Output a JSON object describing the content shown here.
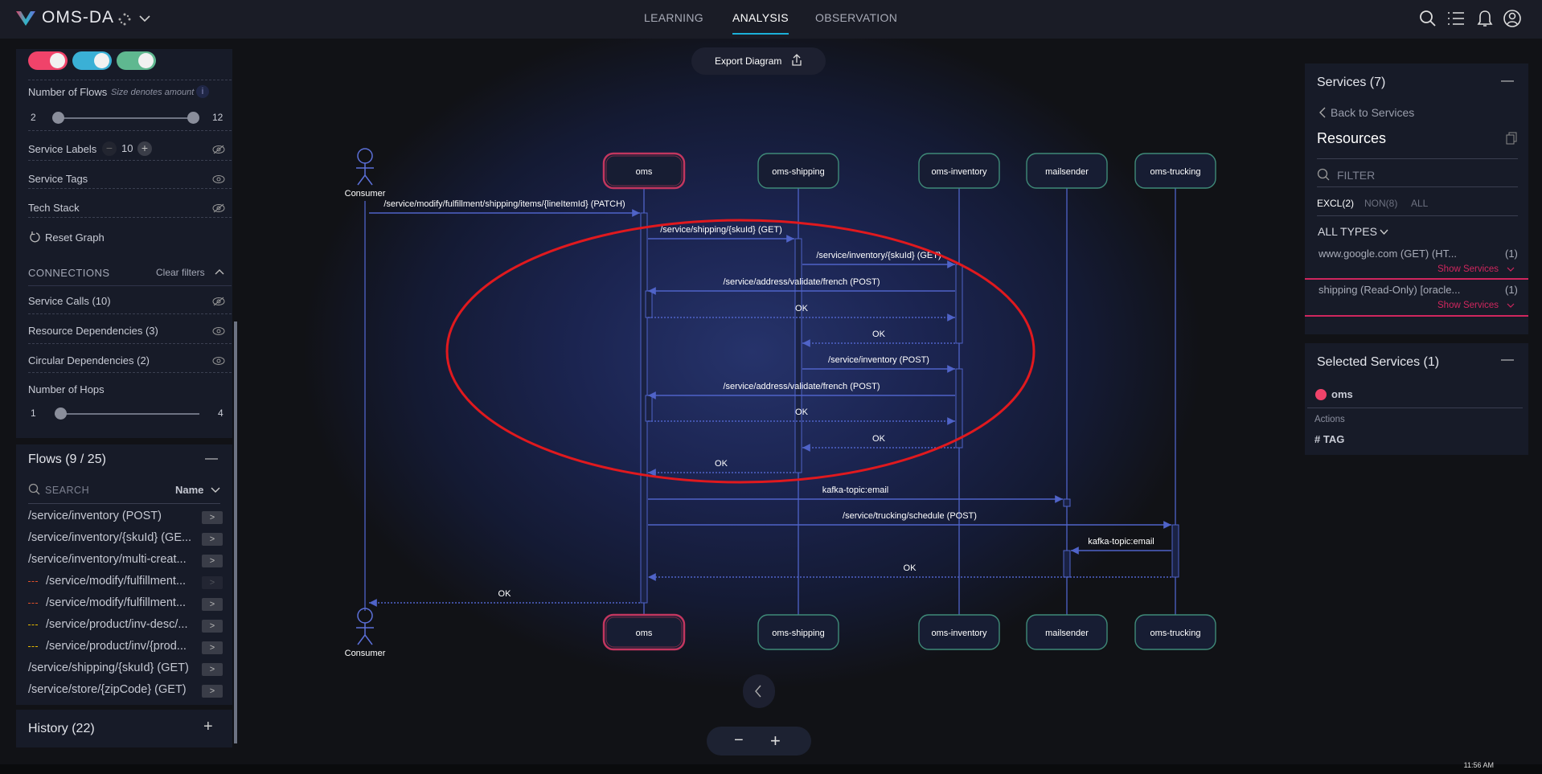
{
  "header": {
    "app_title": "OMS-DA",
    "tabs": [
      {
        "label": "LEARNING"
      },
      {
        "label": "ANALYSIS",
        "active": true
      },
      {
        "label": "OBSERVATION"
      }
    ],
    "icons": [
      "search-icon",
      "list-icon",
      "bell-icon",
      "user-icon"
    ],
    "accent": "#1bb0d8"
  },
  "left_panel": {
    "toggles": [
      {
        "color": "#f0436a",
        "on": true
      },
      {
        "color": "#3ab0d6",
        "on": true
      },
      {
        "color": "#5fb890",
        "on": true
      }
    ],
    "flows_count": {
      "label": "Number of Flows",
      "hint": "Size denotes amount",
      "min": "2",
      "max": "12",
      "value_low": 2,
      "value_high": 12
    },
    "service_labels": {
      "label": "Service Labels",
      "value": "10"
    },
    "service_tags": "Service Tags",
    "tech_stack": "Tech Stack",
    "reset": "Reset Graph",
    "connections": {
      "title": "CONNECTIONS",
      "clear": "Clear filters",
      "items": [
        {
          "label": "Service Calls (10)",
          "visible": false
        },
        {
          "label": "Resource Dependencies (3)",
          "visible": true
        },
        {
          "label": "Circular Dependencies (2)",
          "visible": true
        }
      ]
    },
    "hops": {
      "label": "Number of Hops",
      "min": "1",
      "max": "4",
      "value": 1
    },
    "flows": {
      "title": "Flows (9 / 25)",
      "search_placeholder": "SEARCH",
      "sort": "Name",
      "items": [
        {
          "label": "/service/inventory (POST)",
          "marker": ""
        },
        {
          "label": "/service/inventory/{skuId} (GE...",
          "marker": ""
        },
        {
          "label": "/service/inventory/multi-creat...",
          "marker": ""
        },
        {
          "label": "/service/modify/fulfillment...",
          "marker": "#e0502a"
        },
        {
          "label": "/service/modify/fulfillment...",
          "marker": "#e0502a"
        },
        {
          "label": "/service/product/inv-desc/...",
          "marker": "#e6b800"
        },
        {
          "label": "/service/product/inv/{prod...",
          "marker": "#e6b800"
        },
        {
          "label": "/service/shipping/{skuId} (GET)",
          "marker": ""
        },
        {
          "label": "/service/store/{zipCode} (GET)",
          "marker": ""
        }
      ]
    },
    "history": "History (22)"
  },
  "diagram": {
    "export_label": "Export Diagram",
    "participants": [
      {
        "name": "Consumer",
        "type": "actor"
      },
      {
        "name": "oms",
        "type": "service",
        "selected": true
      },
      {
        "name": "oms-shipping",
        "type": "service"
      },
      {
        "name": "oms-inventory",
        "type": "service"
      },
      {
        "name": "mailsender",
        "type": "service"
      },
      {
        "name": "oms-trucking",
        "type": "service"
      }
    ],
    "messages": [
      {
        "from": "Consumer",
        "to": "oms",
        "label": "/service/modify/fulfillment/shipping/items/{lineItemId} (PATCH)",
        "kind": "call"
      },
      {
        "from": "oms",
        "to": "oms-shipping",
        "label": "/service/shipping/{skuId} (GET)",
        "kind": "call"
      },
      {
        "from": "oms-shipping",
        "to": "oms-inventory",
        "label": "/service/inventory/{skuId} (GET)",
        "kind": "call"
      },
      {
        "from": "oms-inventory",
        "to": "oms",
        "label": "/service/address/validate/french (POST)",
        "kind": "call"
      },
      {
        "from": "oms",
        "to": "oms-inventory",
        "label": "OK",
        "kind": "return"
      },
      {
        "from": "oms-inventory",
        "to": "oms-shipping",
        "label": "OK",
        "kind": "return"
      },
      {
        "from": "oms-shipping",
        "to": "oms-inventory",
        "label": "/service/inventory (POST)",
        "kind": "call"
      },
      {
        "from": "oms-inventory",
        "to": "oms",
        "label": "/service/address/validate/french (POST)",
        "kind": "call"
      },
      {
        "from": "oms",
        "to": "oms-inventory",
        "label": "OK",
        "kind": "return"
      },
      {
        "from": "oms-inventory",
        "to": "oms-shipping",
        "label": "OK",
        "kind": "return"
      },
      {
        "from": "oms-shipping",
        "to": "oms",
        "label": "OK",
        "kind": "return"
      },
      {
        "from": "oms",
        "to": "mailsender",
        "label": "kafka-topic:email",
        "kind": "call"
      },
      {
        "from": "oms",
        "to": "oms-trucking",
        "label": "/service/trucking/schedule (POST)",
        "kind": "call"
      },
      {
        "from": "oms-trucking",
        "to": "mailsender",
        "label": "kafka-topic:email",
        "kind": "call"
      },
      {
        "from": "oms-trucking",
        "to": "oms",
        "label": "OK",
        "kind": "return"
      },
      {
        "from": "oms",
        "to": "Consumer",
        "label": "OK",
        "kind": "return"
      }
    ],
    "annotation_color": "#e0191e"
  },
  "right_panel": {
    "services_title": "Services (7)",
    "back": "Back to Services",
    "resources_title": "Resources",
    "filter_placeholder": "FILTER",
    "filter_tabs": [
      {
        "label": "EXCL(2)",
        "active": true
      },
      {
        "label": "NON(8)"
      },
      {
        "label": "ALL"
      }
    ],
    "types": "ALL TYPES",
    "resources": [
      {
        "label": "www.google.com (GET) (HT...",
        "count": "(1)",
        "action": "Show Services"
      },
      {
        "label": "shipping (Read-Only) [oracle...",
        "count": "(1)",
        "action": "Show Services"
      }
    ],
    "selected_title": "Selected Services (1)",
    "selected": [
      {
        "name": "oms",
        "color": "#f0436a"
      }
    ],
    "actions_label": "Actions",
    "tag_label": "# TAG"
  },
  "taskbar": {
    "time": "11:56 AM"
  }
}
